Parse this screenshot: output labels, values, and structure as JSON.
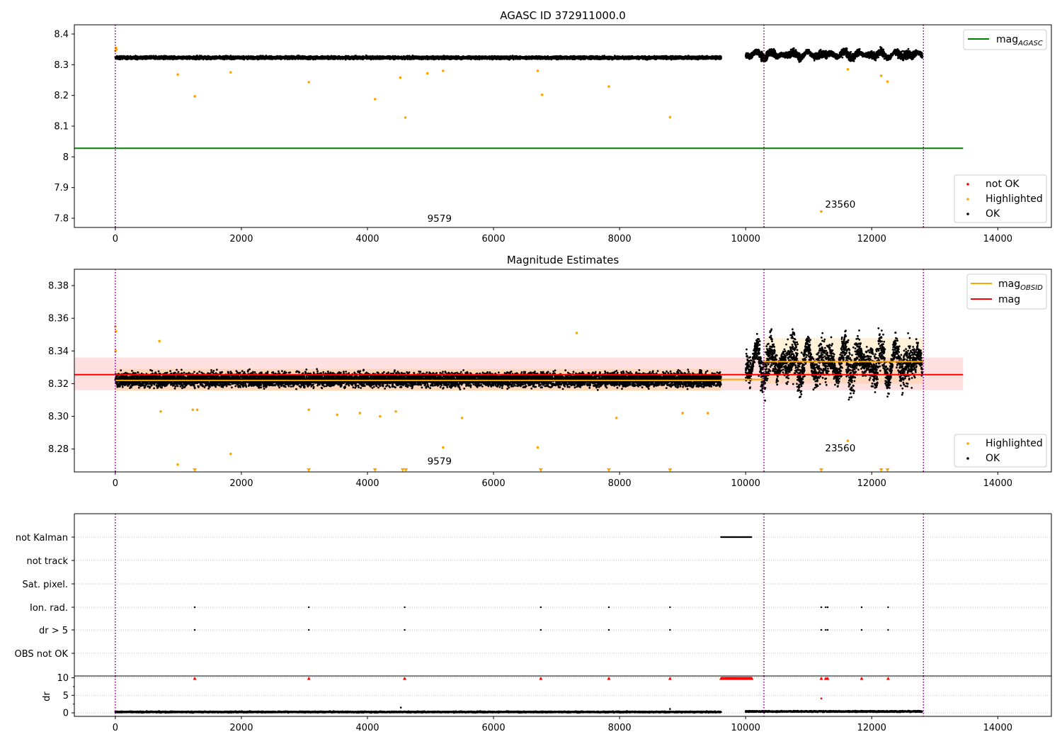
{
  "colors": {
    "ok": "#000000",
    "highlighted": "#ffa500",
    "not_ok": "#ff0000",
    "mag_agasc": "#008000",
    "mag": "#ff0000",
    "mag_obsid": "#ffa500",
    "obs_boundary": "#800080",
    "grid": "#b0b0b0"
  },
  "chart_data": [
    {
      "type": "scatter",
      "title": "AGASC ID 372911000.0",
      "xlim": [
        -650,
        14850
      ],
      "ylim": [
        7.77,
        8.43
      ],
      "x_ticks": [
        0,
        2000,
        4000,
        6000,
        8000,
        10000,
        12000,
        14000
      ],
      "y_ticks": [
        7.8,
        7.9,
        8.0,
        8.1,
        8.2,
        8.3,
        8.4
      ],
      "obs_boundaries": [
        0,
        10290,
        12820
      ],
      "annotations": [
        {
          "text": "9579",
          "x": 4950,
          "y": 7.788
        },
        {
          "text": "23560",
          "x": 11260,
          "y": 7.835
        }
      ],
      "lines": [
        {
          "name": "mag_AGASC",
          "x": [
            -650,
            13450
          ],
          "y": [
            8.028,
            8.028
          ],
          "color": "#008000"
        }
      ],
      "series": [
        {
          "name": "not OK",
          "marker": "dot",
          "color": "#ff0000"
        },
        {
          "name": "Highlighted",
          "marker": "dot",
          "color": "#ffa500",
          "points": [
            [
              0,
              8.345
            ],
            [
              10,
              8.355
            ],
            [
              20,
              8.35
            ],
            [
              990,
              8.268
            ],
            [
              1260,
              8.197
            ],
            [
              1830,
              8.275
            ],
            [
              3070,
              8.243
            ],
            [
              4120,
              8.188
            ],
            [
              4520,
              8.258
            ],
            [
              4600,
              8.128
            ],
            [
              4950,
              8.272
            ],
            [
              5200,
              8.28
            ],
            [
              6700,
              8.28
            ],
            [
              6770,
              8.202
            ],
            [
              7830,
              8.229
            ],
            [
              8800,
              8.129
            ],
            [
              11200,
              7.822
            ],
            [
              11620,
              8.285
            ],
            [
              12150,
              8.264
            ],
            [
              12250,
              8.245
            ]
          ]
        },
        {
          "name": "OK",
          "marker": "dot",
          "color": "#000000"
        }
      ],
      "ok_segments": [
        {
          "x_start": 0,
          "x_end": 9610,
          "center": 8.323,
          "spread": 0.006
        },
        {
          "x_start": 10000,
          "x_end": 12800,
          "center": 8.333,
          "spread": 0.012
        }
      ],
      "legend_lines": [
        {
          "label": "mag",
          "sub": "AGASC",
          "color": "#008000"
        }
      ],
      "legend_points": [
        {
          "label": "not OK",
          "color": "#ff0000"
        },
        {
          "label": "Highlighted",
          "color": "#ffa500"
        },
        {
          "label": "OK",
          "color": "#000000"
        }
      ]
    },
    {
      "type": "scatter",
      "title": "Magnitude Estimates",
      "xlim": [
        -650,
        14850
      ],
      "ylim": [
        8.266,
        8.39
      ],
      "x_ticks": [
        0,
        2000,
        4000,
        6000,
        8000,
        10000,
        12000,
        14000
      ],
      "y_ticks": [
        8.28,
        8.3,
        8.32,
        8.34,
        8.36,
        8.38
      ],
      "y_tick_labels": [
        "8.28",
        "8.30",
        "8.32",
        "8.34",
        "8.36",
        "8.38"
      ],
      "obs_boundaries": [
        0,
        10290,
        12820
      ],
      "annotations": [
        {
          "text": "9579",
          "x": 4950,
          "y": 8.2705
        },
        {
          "text": "23560",
          "x": 11260,
          "y": 8.2785
        }
      ],
      "bands": [
        {
          "name": "mag",
          "x": [
            -650,
            13450
          ],
          "y": [
            8.316,
            8.336
          ],
          "color": "#ff0000",
          "opacity": 0.12
        },
        {
          "name": "mag_OBSID 9579",
          "x": [
            0,
            9610
          ],
          "y": [
            8.3155,
            8.329
          ],
          "color": "#ffa500",
          "opacity": 0.18
        },
        {
          "name": "mag_OBSID 23560",
          "x": [
            10290,
            12820
          ],
          "y": [
            8.32,
            8.348
          ],
          "color": "#ffa500",
          "opacity": 0.15
        }
      ],
      "lines": [
        {
          "name": "mag",
          "x": [
            -650,
            13450
          ],
          "y": [
            8.3255,
            8.3255
          ],
          "color": "#ff0000"
        },
        {
          "name": "mag_OBSID",
          "x": [
            0,
            9610
          ],
          "y": [
            8.322,
            8.322
          ],
          "color": "#ffa500"
        },
        {
          "name": "mag_OBSID",
          "x": [
            9610,
            10290
          ],
          "y": [
            8.3225,
            8.3225
          ],
          "color": "#ffa500"
        },
        {
          "name": "mag_OBSID",
          "x": [
            10290,
            12820
          ],
          "y": [
            8.3335,
            8.3335
          ],
          "color": "#ffa500"
        }
      ],
      "series": [
        {
          "name": "Highlighted",
          "marker": "dot",
          "color": "#ffa500",
          "points": [
            [
              0,
              8.355
            ],
            [
              10,
              8.352
            ],
            [
              5,
              8.34
            ],
            [
              700,
              8.346
            ],
            [
              720,
              8.303
            ],
            [
              990,
              8.2705
            ],
            [
              1230,
              8.304
            ],
            [
              1300,
              8.304
            ],
            [
              1830,
              8.277
            ],
            [
              3070,
              8.304
            ],
            [
              3520,
              8.301
            ],
            [
              3880,
              8.302
            ],
            [
              4200,
              8.3
            ],
            [
              4450,
              8.303
            ],
            [
              5200,
              8.281
            ],
            [
              5500,
              8.299
            ],
            [
              6700,
              8.281
            ],
            [
              7320,
              8.351
            ],
            [
              7950,
              8.299
            ],
            [
              9000,
              8.302
            ],
            [
              9400,
              8.302
            ],
            [
              11620,
              8.285
            ]
          ]
        },
        {
          "name": "Highlighted (below range)",
          "marker": "triangle-down",
          "color": "#ffa500",
          "points": [
            [
              1260,
              8.2665
            ],
            [
              3070,
              8.2665
            ],
            [
              4120,
              8.2665
            ],
            [
              4560,
              8.2665
            ],
            [
              4610,
              8.2665
            ],
            [
              6750,
              8.2665
            ],
            [
              7830,
              8.2665
            ],
            [
              8800,
              8.2665
            ],
            [
              11200,
              8.2665
            ],
            [
              12150,
              8.2665
            ],
            [
              12250,
              8.2665
            ]
          ]
        },
        {
          "name": "OK",
          "marker": "dot",
          "color": "#000000"
        }
      ],
      "ok_segments": [
        {
          "x_start": 0,
          "x_end": 9610,
          "center": 8.3225,
          "spread": 0.0055
        },
        {
          "x_start": 10000,
          "x_end": 12800,
          "center": 8.333,
          "spread": 0.012
        }
      ],
      "legend_lines": [
        {
          "label": "mag",
          "sub": "OBSID",
          "color": "#ffa500"
        },
        {
          "label": "mag",
          "sub": "",
          "color": "#ff0000"
        }
      ],
      "legend_points": [
        {
          "label": "Highlighted",
          "color": "#ffa500"
        },
        {
          "label": "OK",
          "color": "#000000"
        }
      ]
    },
    {
      "type": "scatter",
      "title": "",
      "xlim": [
        -650,
        14850
      ],
      "categories": [
        "not Kalman",
        "not track",
        "Sat. pixel.",
        "Ion. rad.",
        "dr > 5",
        "OBS not OK"
      ],
      "obs_boundaries": [
        0,
        10290,
        12820
      ],
      "flags": {
        "not Kalman": [
          {
            "x_start": 9610,
            "x_end": 10100
          }
        ],
        "not track": [],
        "Sat. pixel.": [],
        "Ion. rad.": [
          1260,
          3070,
          4590,
          6750,
          7830,
          8800,
          11200,
          11270,
          11300,
          11840,
          12260
        ],
        "dr > 5": [
          1260,
          3070,
          4590,
          6750,
          7830,
          8800,
          11200,
          11270,
          11300,
          11840,
          12260
        ],
        "OBS not OK": []
      }
    },
    {
      "type": "scatter",
      "title": "",
      "ylabel": "dr",
      "xlim": [
        -650,
        14850
      ],
      "ylim": [
        -1,
        10.5
      ],
      "x_ticks": [
        0,
        2000,
        4000,
        6000,
        8000,
        10000,
        12000,
        14000
      ],
      "y_ticks": [
        0,
        5,
        10
      ],
      "obs_boundaries": [
        0,
        10290,
        12820
      ],
      "ok_segments": [
        {
          "x_start": 0,
          "x_end": 9610,
          "center": 0.25,
          "spread": 0.2
        },
        {
          "x_start": 10000,
          "x_end": 12800,
          "center": 0.4,
          "spread": 0.2
        }
      ],
      "clipped_markers": {
        "marker": "triangle-up",
        "color": "#ff0000",
        "y": 9.8,
        "x": [
          1260,
          3070,
          4590,
          6750,
          7830,
          8800,
          11200,
          11270,
          11300,
          11840,
          12260
        ],
        "dense_range": [
          9610,
          10100
        ]
      },
      "extra_points": [
        {
          "x": 11200,
          "y": 4.1,
          "color": "#ff0000"
        },
        {
          "x": 4530,
          "y": 1.5,
          "color": "#000000"
        },
        {
          "x": 8800,
          "y": 1.1,
          "color": "#000000"
        }
      ]
    }
  ]
}
